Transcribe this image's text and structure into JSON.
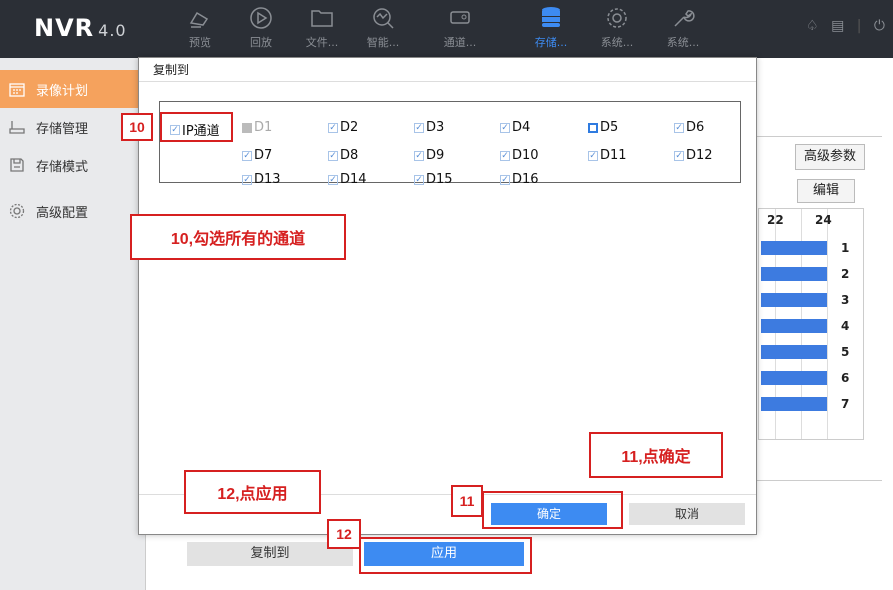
{
  "topbar": {
    "logo": "NVR",
    "version": "4.0",
    "nav": [
      {
        "label": "预览",
        "icon": "camera-icon"
      },
      {
        "label": "回放",
        "icon": "playback-icon"
      },
      {
        "label": "文件...",
        "icon": "folder-icon"
      },
      {
        "label": "智能...",
        "icon": "smart-search-icon"
      },
      {
        "label": "通道...",
        "icon": "camera-channel-icon"
      },
      {
        "label": "存储...",
        "icon": "storage-icon",
        "active": true
      },
      {
        "label": "系统...",
        "icon": "gear-icon"
      },
      {
        "label": "系统...",
        "icon": "wrench-icon"
      }
    ]
  },
  "sidebar": {
    "items": [
      {
        "label": "录像计划",
        "icon": "calendar-icon",
        "active": true
      },
      {
        "label": "存储管理",
        "icon": "hdd-icon"
      },
      {
        "label": "存储模式",
        "icon": "save-icon"
      },
      {
        "label": "高级配置",
        "icon": "advanced-gear-icon"
      }
    ]
  },
  "background": {
    "advanced_params": "高级参数",
    "edit": "编辑",
    "grid_headers": [
      "22",
      "24"
    ],
    "grid_rows": [
      "1",
      "2",
      "3",
      "4",
      "5",
      "6",
      "7"
    ]
  },
  "dialog": {
    "title": "复制到",
    "ip_channel": "IP通道",
    "channels": [
      {
        "name": "D1",
        "state": "disabled"
      },
      {
        "name": "D2",
        "state": "checked"
      },
      {
        "name": "D3",
        "state": "checked"
      },
      {
        "name": "D4",
        "state": "checked"
      },
      {
        "name": "D5",
        "state": "current"
      },
      {
        "name": "D6",
        "state": "checked"
      },
      {
        "name": "D7",
        "state": "checked"
      },
      {
        "name": "D8",
        "state": "checked"
      },
      {
        "name": "D9",
        "state": "checked"
      },
      {
        "name": "D10",
        "state": "checked"
      },
      {
        "name": "D11",
        "state": "checked"
      },
      {
        "name": "D12",
        "state": "checked"
      },
      {
        "name": "D13",
        "state": "checked"
      },
      {
        "name": "D14",
        "state": "checked"
      },
      {
        "name": "D15",
        "state": "checked"
      },
      {
        "name": "D16",
        "state": "checked"
      }
    ],
    "ok": "确定",
    "cancel": "取消"
  },
  "buttons": {
    "copy_to": "复制到",
    "apply": "应用"
  },
  "annotations": {
    "badge_10": "10",
    "badge_11": "11",
    "badge_12": "12",
    "note_10": "10,勾选所有的通道",
    "note_11": "11,点确定",
    "note_12": "12,点应用"
  },
  "colors": {
    "accent": "#3d8bf2",
    "sidebar_active": "#f5a25d",
    "annotation": "#d62020",
    "topbar": "#2b2f36"
  }
}
